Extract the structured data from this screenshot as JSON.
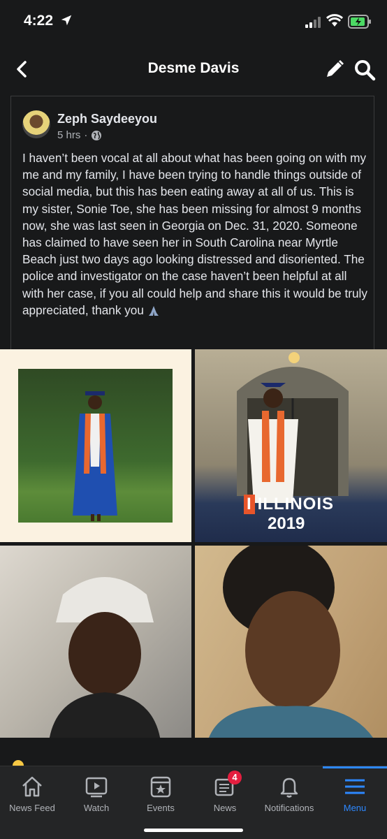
{
  "status_bar": {
    "time": "4:22"
  },
  "header": {
    "title": "Desme Davis"
  },
  "post": {
    "author": "Zeph Saydeeyou",
    "time": "5 hrs",
    "separator": "·",
    "text": "I haven’t been vocal at all about what has been going on with my me and my family, I have been trying to handle things outside of social media, but this has been eating away at all of us. This is my sister, Sonie Toe, she has been missing for almost 9 months now, she was last seen in Georgia on Dec. 31, 2020. Someone has claimed to have seen her in South Carolina near Myrtle Beach just two days ago looking distressed and disoriented. The police and  investigator on the case haven’t been helpful at all with her case, if you all could help and share this it would be truly appreciated, thank you",
    "photo_caption_brand": "ILLINOIS",
    "photo_caption_brand_initial": "I",
    "photo_caption_year": "2019"
  },
  "tab_bar": {
    "items": [
      {
        "label": "News Feed",
        "icon": "home-icon"
      },
      {
        "label": "Watch",
        "icon": "watch-icon"
      },
      {
        "label": "Events",
        "icon": "events-icon"
      },
      {
        "label": "News",
        "icon": "news-icon",
        "badge": "4"
      },
      {
        "label": "Notifications",
        "icon": "bell-icon"
      },
      {
        "label": "Menu",
        "icon": "menu-icon",
        "active": true
      }
    ]
  },
  "colors": {
    "accent": "#2d88ff",
    "badge": "#e41e3f",
    "background": "#18191a"
  }
}
